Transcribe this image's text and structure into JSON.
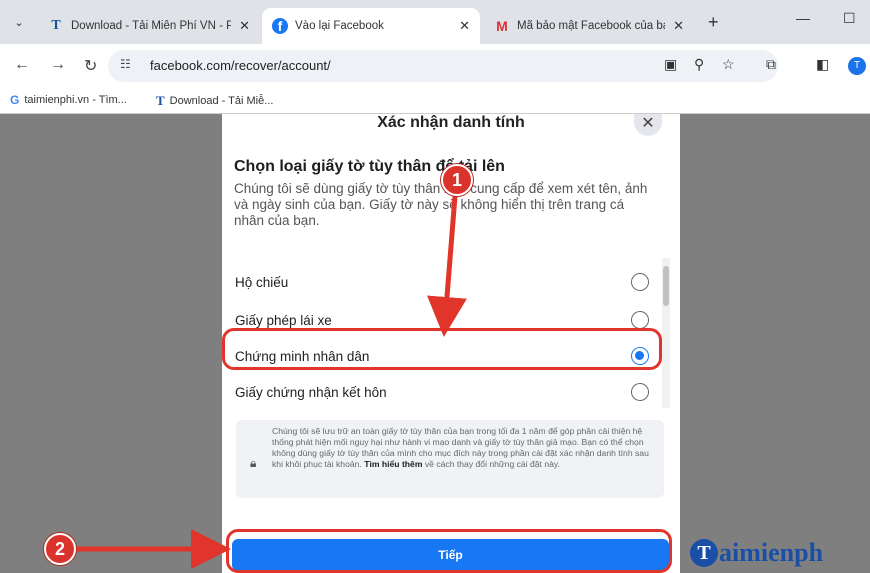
{
  "browser": {
    "tabs": [
      {
        "title": "Download - Tải Miễn Phí VN - P",
        "favicon": "T"
      },
      {
        "title": "Vào lại Facebook",
        "favicon": "f"
      },
      {
        "title": "Mã bảo mật Facebook của bạn",
        "favicon": "M"
      }
    ],
    "url": "facebook.com/recover/account/",
    "avatar_letter": "T",
    "bookmarks": [
      {
        "label": "taimienphi.vn - Tìm..."
      },
      {
        "label": "Download - Tải Miễ..."
      }
    ]
  },
  "dialog": {
    "title": "Xác nhận danh tính",
    "heading": "Chọn loại giấy tờ tùy thân để tải lên",
    "description": "Chúng tôi sẽ dùng giấy tờ tùy thân bạn cung cấp để xem xét tên, ảnh và ngày sinh của bạn. Giấy tờ này sẽ không hiển thị trên trang cá nhân của bạn.",
    "options": [
      {
        "label": "Hộ chiếu",
        "checked": false
      },
      {
        "label": "Giấy phép lái xe",
        "checked": false
      },
      {
        "label": "Chứng minh nhân dân",
        "checked": true
      },
      {
        "label": "Giấy chứng nhận kết hôn",
        "checked": false
      }
    ],
    "notice_text": "Chúng tôi sẽ lưu trữ an toàn giấy tờ tùy thân của bạn trong tối đa 1 năm để góp phần cải thiện hệ thống phát hiện mối nguy hại như hành vi mạo danh và giấy tờ tùy thân giả mạo. Bạn có thể chọn không dùng giấy tờ tùy thân của mình cho mục đích này trong phần cài đặt xác nhận danh tính sau khi khôi phục tài khoản.",
    "notice_link": "Tìm hiểu thêm",
    "notice_tail": "về cách thay đổi những cài đặt này.",
    "next_label": "Tiếp"
  },
  "annotations": {
    "step1": "1",
    "step2": "2",
    "color": "#e1352b"
  },
  "watermark": {
    "logo_letter": "T",
    "text": "aimienph"
  }
}
